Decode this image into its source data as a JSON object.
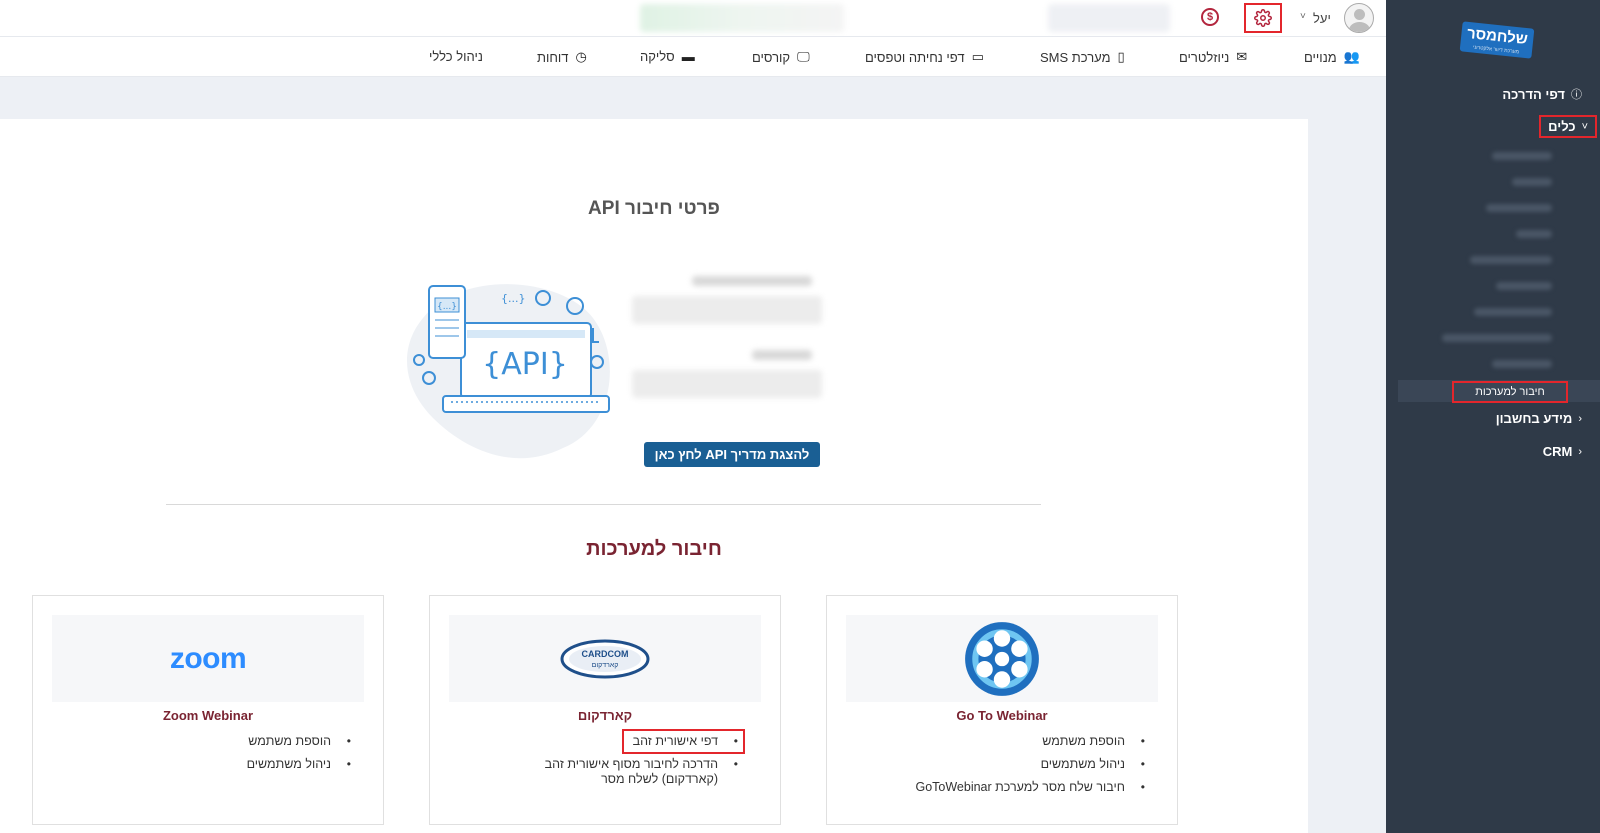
{
  "sidebar": {
    "logo_text": "שלחמסר",
    "logo_subtext": "מערכת דיוור אלקטרוני",
    "items": [
      {
        "label": "דפי הדרכה",
        "icon": "info-icon"
      },
      {
        "label": "כלים",
        "icon": "chevron-down-icon"
      },
      {
        "label": "מידע בחשבון",
        "icon": "chevron-left-icon"
      },
      {
        "label": "CRM",
        "icon": "chevron-left-icon"
      }
    ],
    "active_subitem": "חיבור למערכות"
  },
  "topbar": {
    "username": "יעל",
    "icons": [
      "user-avatar-icon",
      "chevron-down-icon",
      "gear-icon",
      "dollar-icon"
    ]
  },
  "nav": {
    "items": [
      {
        "label": "מנויים",
        "icon": "users-cog-icon"
      },
      {
        "label": "ניוזלטרים",
        "icon": "envelope-icon"
      },
      {
        "label": "מערכת SMS",
        "icon": "mobile-icon"
      },
      {
        "label": "דפי נחיתה וטפסים",
        "icon": "card-icon"
      },
      {
        "label": "קורסים",
        "icon": "monitor-icon"
      },
      {
        "label": "סליקה",
        "icon": "money-bill-icon"
      },
      {
        "label": "דוחות",
        "icon": "clock-icon"
      },
      {
        "label": "ניהול כללי",
        "icon": ""
      }
    ]
  },
  "api": {
    "title": "פרטי חיבור API",
    "illustration_text": "{API}",
    "button_label": "להצגת מדריך API לחץ כאן"
  },
  "systems": {
    "title": "חיבור למערכות",
    "cards": [
      {
        "name": "Go To Webinar",
        "logo": "gotowebinar-logo",
        "links": [
          "הוספת משתמש",
          "ניהול משתמשים",
          "חיבור שלח מסר למערכת GoToWebinar"
        ]
      },
      {
        "name": "קארדקום",
        "logo": "cardcom-logo",
        "logo_text": "CARDCOM",
        "logo_subtext": "קארדקום",
        "links": [
          "דפי אישורית זהב",
          "הדרכה לחיבור מסוף אישורית זהב (קארדקום) לשלח מסר"
        ]
      },
      {
        "name": "Zoom Webinar",
        "logo": "zoom-logo",
        "logo_text": "zoom",
        "links": [
          "הוספת משתמש",
          "ניהול משתמשים"
        ]
      }
    ]
  },
  "colors": {
    "sidebar_bg": "#2f3a48",
    "highlight": "#e3262c",
    "primary_button": "#1a5f94",
    "section_title": "#7a2432"
  }
}
